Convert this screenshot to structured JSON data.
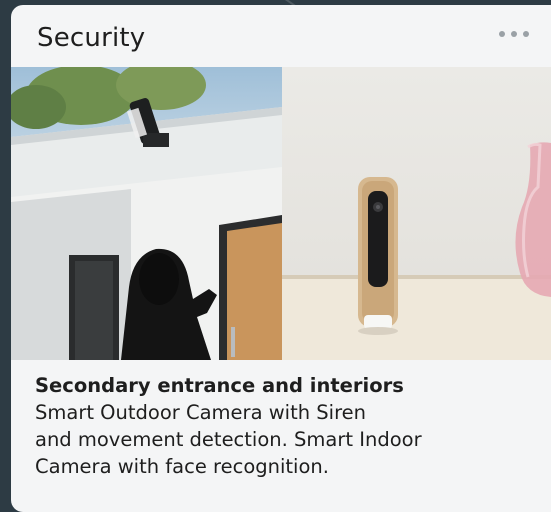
{
  "card": {
    "title": "Security",
    "more_icon": "more-horizontal-icon",
    "images": [
      {
        "name": "outdoor-camera-photo"
      },
      {
        "name": "indoor-camera-photo"
      }
    ],
    "caption": {
      "heading": "Secondary entrance and interiors",
      "body": "Smart Outdoor Camera with Siren\nand movement detection. Smart Indoor\nCamera with face recognition."
    }
  },
  "colors": {
    "page_background": "#2d3b44",
    "card_background": "#f4f5f6",
    "text": "#1e1e1e",
    "more_dots": "#9aa1a6"
  }
}
